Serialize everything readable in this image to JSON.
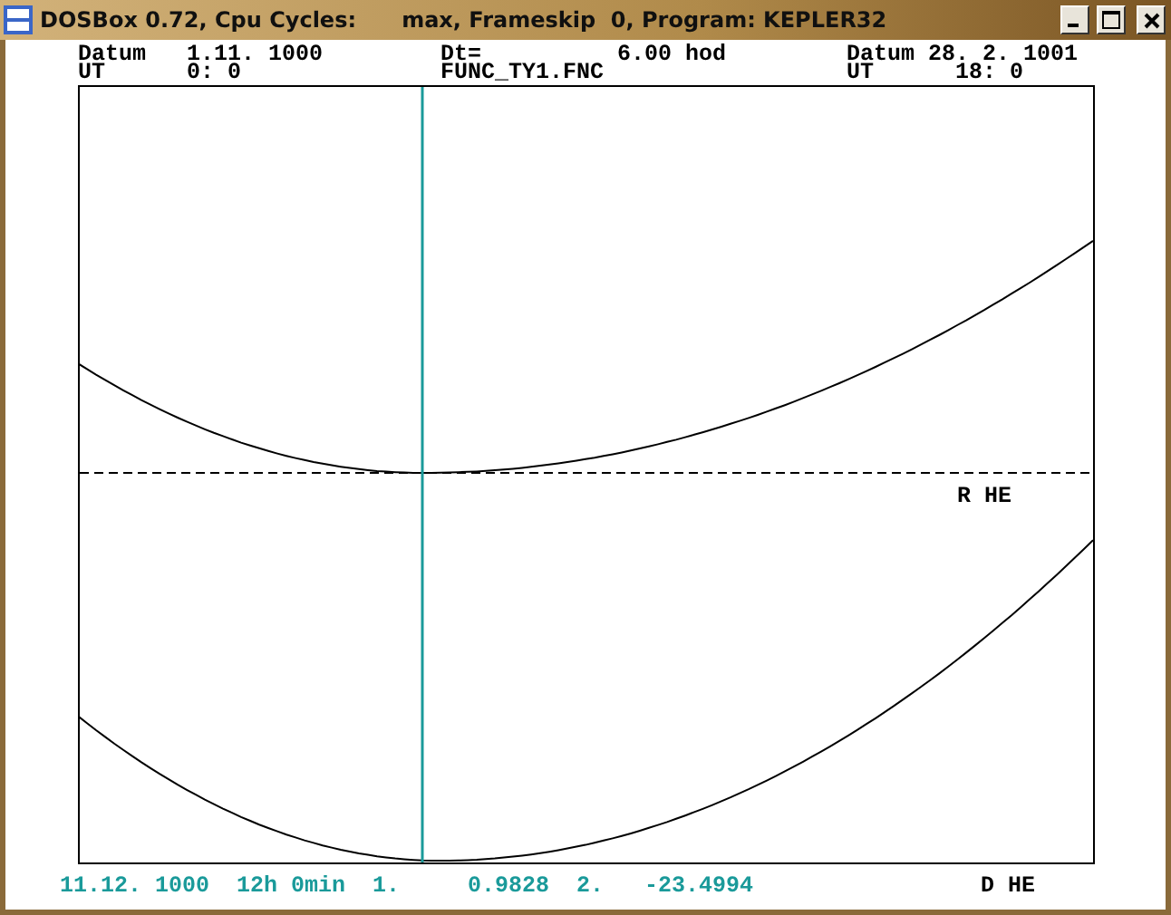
{
  "window": {
    "title": "DOSBox 0.72, Cpu Cycles:      max, Frameskip  0, Program: KEPLER32"
  },
  "header": {
    "left": [
      "Datum   1.11. 1000",
      "UT      0: 0"
    ],
    "middle": [
      "Dt=          6.00 hod",
      "FUNC_TY1.FNC"
    ],
    "right": [
      "Datum 28. 2. 1001",
      "UT      18: 0"
    ]
  },
  "plot": {
    "line_label": "R HE"
  },
  "footer": {
    "readout": "11.12. 1000  12h 0min  1.     0.9828  2.   -23.4994",
    "label": "D HE"
  }
}
